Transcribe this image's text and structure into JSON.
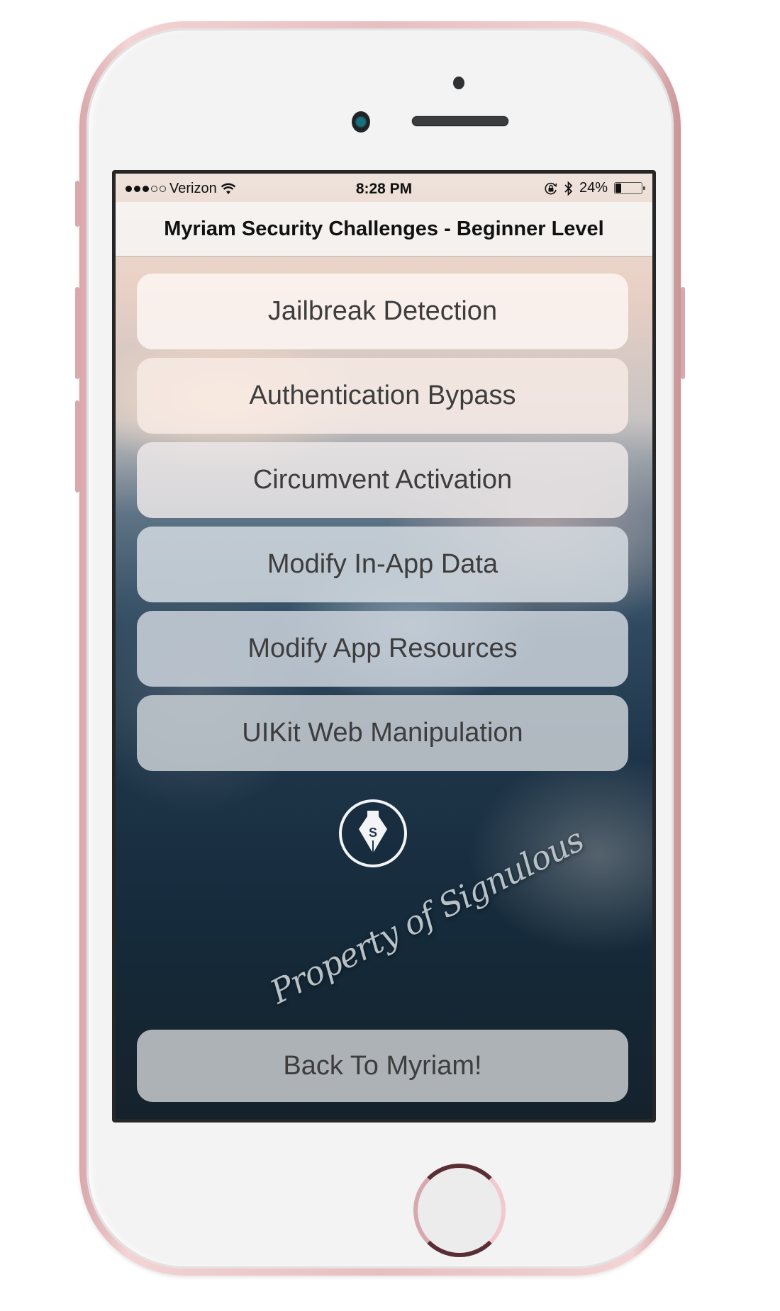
{
  "status_bar": {
    "signal_bars_filled": 3,
    "signal_bars_total": 5,
    "carrier": "Verizon",
    "wifi_icon": "wifi-icon",
    "time": "8:28 PM",
    "orientation_lock_icon": "orientation-lock-icon",
    "bluetooth_icon": "bluetooth-icon",
    "battery_percent_label": "24%",
    "battery_level": 0.24
  },
  "header": {
    "title": "Myriam Security Challenges - Beginner Level"
  },
  "menu": {
    "items": [
      {
        "label": "Jailbreak Detection"
      },
      {
        "label": "Authentication Bypass"
      },
      {
        "label": "Circumvent Activation"
      },
      {
        "label": "Modify In-App Data"
      },
      {
        "label": "Modify App Resources"
      },
      {
        "label": "UIKit Web Manipulation"
      }
    ]
  },
  "branding": {
    "logo_icon": "pen-nib-logo-icon",
    "logo_letter": "S",
    "watermark": "Property of Signulous"
  },
  "footer": {
    "back_label": "Back To Myriam!"
  },
  "colors": {
    "phone_frame": "#e7bfc1",
    "button_text": "#3d3d3d",
    "background_dark": "#1e3549"
  }
}
